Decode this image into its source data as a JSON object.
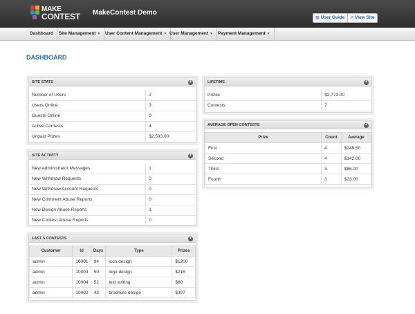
{
  "header": {
    "logo_line1": "MAKE",
    "logo_line2": "CONTEST",
    "title": "MakeContest Demo",
    "user_guide": "User Guide",
    "view_site": "View Site"
  },
  "nav": {
    "items": [
      {
        "label": "Dashboard"
      },
      {
        "label": "Site Management"
      },
      {
        "label": "User Content Management"
      },
      {
        "label": "User Management"
      },
      {
        "label": "Payment Management"
      }
    ]
  },
  "page": {
    "title": "DASHBOARD"
  },
  "site_stats": {
    "title": "SITE STATS",
    "rows": [
      {
        "label": "Number of Users",
        "value": "2"
      },
      {
        "label": "Users Online",
        "value": "3"
      },
      {
        "label": "Guests Online",
        "value": "0"
      },
      {
        "label": "Active Contests",
        "value": "4"
      },
      {
        "label": "Unpaid Prizes",
        "value": "$2,593.00"
      }
    ]
  },
  "site_activity": {
    "title": "SITE ACTIVITY",
    "rows": [
      {
        "label": "New Administrator Messages",
        "value": "1"
      },
      {
        "label": "New Withdraw Requests",
        "value": "0"
      },
      {
        "label": "New Withdraw Account Requests",
        "value": "0"
      },
      {
        "label": "New Comment Abuse Reports",
        "value": "0"
      },
      {
        "label": "New Design Abuse Reports",
        "value": "1"
      },
      {
        "label": "New Contest Abuse Reports",
        "value": "0"
      }
    ]
  },
  "last_contests": {
    "title": "LAST 5 CONTESTS",
    "columns": [
      "Customer",
      "Id",
      "Days",
      "Type",
      "Prizes"
    ],
    "rows": [
      {
        "customer": "admin",
        "id": "10001",
        "days": "94",
        "type": "icon design",
        "prize": "$1200"
      },
      {
        "customer": "admin",
        "id": "10003",
        "days": "50",
        "type": "logo design",
        "prize": "$216"
      },
      {
        "customer": "admin",
        "id": "10004",
        "days": "52",
        "type": "text writing",
        "prize": "$80"
      },
      {
        "customer": "admin",
        "id": "10002",
        "days": "43",
        "type": "brochure design",
        "prize": "$397"
      }
    ]
  },
  "lifetime": {
    "title": "LIFETIME",
    "rows": [
      {
        "label": "Prizes",
        "value": "$2,773.00"
      },
      {
        "label": "Contests",
        "value": "7"
      }
    ]
  },
  "avg_open": {
    "title": "AVERAGE OPEN CONTESTS",
    "columns": [
      "Prize",
      "Count",
      "Average"
    ],
    "rows": [
      {
        "prize": "First",
        "count": "4",
        "average": "$249.50"
      },
      {
        "prize": "Second",
        "count": "4",
        "average": "$142.00"
      },
      {
        "prize": "Third",
        "count": "3",
        "average": "$86.00"
      },
      {
        "prize": "Fourth",
        "count": "3",
        "average": "$23.00"
      }
    ]
  },
  "toggle_icon": "+",
  "colors": {
    "accent": "#2a6cb5",
    "header_bg": "#3a3a3a"
  }
}
